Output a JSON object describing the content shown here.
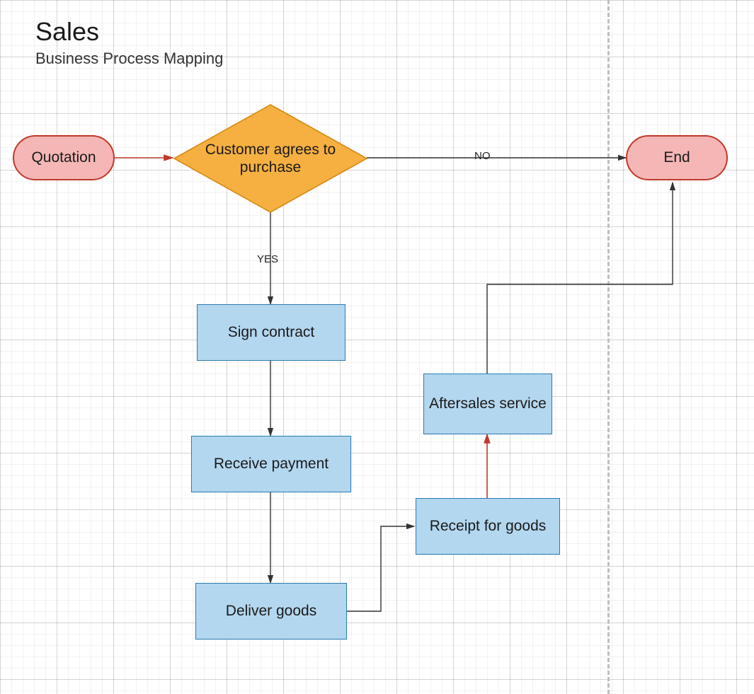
{
  "header": {
    "title": "Sales",
    "subtitle": "Business Process Mapping"
  },
  "nodes": {
    "quotation": "Quotation",
    "decision": "Customer agrees to purchase",
    "sign_contract": "Sign contract",
    "receive_payment": "Receive payment",
    "deliver_goods": "Deliver goods",
    "receipt_for_goods": "Receipt for goods",
    "aftersales": "Aftersales service",
    "end": "End"
  },
  "edges": {
    "yes": "YES",
    "no": "NO"
  },
  "chart_data": {
    "type": "flowchart",
    "title": "Sales — Business Process Mapping",
    "nodes": [
      {
        "id": "quotation",
        "label": "Quotation",
        "shape": "terminator",
        "fill": "#f5b6b6",
        "stroke": "#c0392b"
      },
      {
        "id": "decision",
        "label": "Customer agrees to purchase",
        "shape": "decision",
        "fill": "#f5b041",
        "stroke": "#d68910"
      },
      {
        "id": "sign_contract",
        "label": "Sign contract",
        "shape": "process",
        "fill": "#b3d7ef",
        "stroke": "#2a7ab0"
      },
      {
        "id": "receive_payment",
        "label": "Receive payment",
        "shape": "process",
        "fill": "#b3d7ef",
        "stroke": "#2a7ab0"
      },
      {
        "id": "deliver_goods",
        "label": "Deliver goods",
        "shape": "process",
        "fill": "#b3d7ef",
        "stroke": "#2a7ab0"
      },
      {
        "id": "receipt_for_goods",
        "label": "Receipt for goods",
        "shape": "process",
        "fill": "#b3d7ef",
        "stroke": "#2a7ab0"
      },
      {
        "id": "aftersales",
        "label": "Aftersales service",
        "shape": "process",
        "fill": "#b3d7ef",
        "stroke": "#2a7ab0"
      },
      {
        "id": "end",
        "label": "End",
        "shape": "terminator",
        "fill": "#f5b6b6",
        "stroke": "#c0392b"
      }
    ],
    "edges": [
      {
        "from": "quotation",
        "to": "decision",
        "color": "#c0392b"
      },
      {
        "from": "decision",
        "to": "end",
        "label": "NO",
        "color": "#333333"
      },
      {
        "from": "decision",
        "to": "sign_contract",
        "label": "YES",
        "color": "#333333"
      },
      {
        "from": "sign_contract",
        "to": "receive_payment",
        "color": "#333333"
      },
      {
        "from": "receive_payment",
        "to": "deliver_goods",
        "color": "#333333"
      },
      {
        "from": "deliver_goods",
        "to": "receipt_for_goods",
        "color": "#333333"
      },
      {
        "from": "receipt_for_goods",
        "to": "aftersales",
        "color": "#c0392b"
      },
      {
        "from": "aftersales",
        "to": "end",
        "color": "#333333"
      }
    ]
  }
}
